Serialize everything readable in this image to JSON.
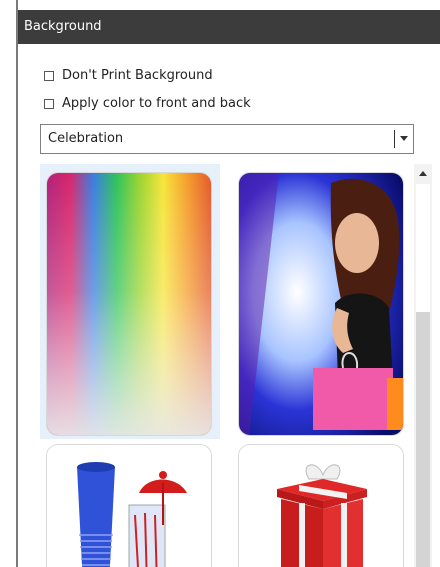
{
  "panel": {
    "title": "Background",
    "options": [
      {
        "label": "Don't Print Background",
        "checked": false
      },
      {
        "label": "Apply color to front and back",
        "checked": false
      }
    ],
    "category": {
      "selected": "Celebration"
    }
  },
  "thumbnails": [
    {
      "icon": "rainbow-gradient",
      "selected": true
    },
    {
      "icon": "woman-shopping-bags",
      "selected": false
    },
    {
      "icon": "blue-party-cups",
      "selected": false
    },
    {
      "icon": "red-gift-box",
      "selected": false
    }
  ],
  "colors": {
    "titlebar": "#3c3c3c",
    "selection": "#e6f0fa"
  }
}
